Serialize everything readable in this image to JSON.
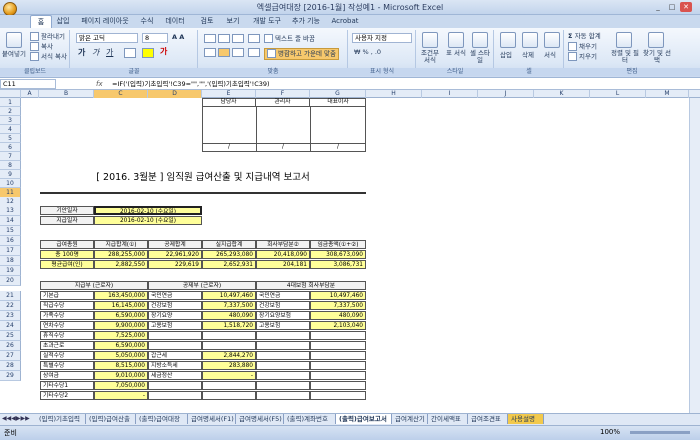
{
  "title": "엑셀급여대장 [2016-1월] 작성예1 - Microsoft Excel",
  "tabs": [
    "홈",
    "삽입",
    "페이지 레이아웃",
    "수식",
    "데이터",
    "검토",
    "보기",
    "개발 도구",
    "추가 기능",
    "Acrobat"
  ],
  "ribbon": {
    "paste": "붙여넣기",
    "cut": "잘라내기",
    "copy": "복사",
    "format_painter": "서식 복사",
    "font_name": "맑은 고딕",
    "font_size": "8",
    "wrap_text": "텍스트 줄 바꿈",
    "merge_center": "병합하고 가운데 맞춤",
    "number_format": "사용자 지정",
    "cond_format": "조건부 서식",
    "table_format": "표 서식",
    "cell_style": "셀 스타일",
    "insert": "삽입",
    "delete": "삭제",
    "format": "서식",
    "autosum": "자동 합계",
    "fill": "채우기",
    "clear": "지우기",
    "sort": "정렬 및 필터",
    "find": "찾기 및 선택",
    "groups": [
      "클립보드",
      "글꼴",
      "맞춤",
      "표시 형식",
      "스타일",
      "셀",
      "편집"
    ]
  },
  "formula_bar": {
    "cell": "C11",
    "fx": "fx",
    "formula": "=IF('(입력)기초입력'!C39=\"\",\"\",'(입력)기초입력'!C39)"
  },
  "columns": [
    "A",
    "B",
    "C",
    "D",
    "E",
    "F",
    "G",
    "H",
    "I",
    "J",
    "K",
    "L",
    "M"
  ],
  "rows": [
    "1",
    "2",
    "3",
    "4",
    "5",
    "6",
    "7",
    "8",
    "9",
    "10",
    "11",
    "12",
    "13",
    "14",
    "15",
    "16",
    "17",
    "18",
    "19",
    "20",
    "21",
    "22",
    "23",
    "24",
    "25",
    "26",
    "27",
    "28",
    "29"
  ],
  "approval": {
    "headers": [
      "담당자",
      "관리자",
      "대표이사"
    ],
    "marks": [
      "/",
      "/",
      "/"
    ]
  },
  "report_title": "[ 2016. 3월분 ] 임직원 급여산출 및 지급내역 보고서",
  "dates": [
    {
      "label": "기안일자",
      "value": "2016-02-10 (수요일)"
    },
    {
      "label": "지급일자",
      "value": "2016-02-10 (수요일)"
    }
  ],
  "summary": {
    "headers": [
      "급여총원",
      "지급합계(①)",
      "공제합계",
      "실지급합계",
      "회사부담분②",
      "임금총액(①+②)"
    ],
    "rows": [
      [
        "총 100명",
        "288,255,000",
        "22,961,920",
        "265,293,080",
        "20,418,090",
        "308,673,090"
      ],
      [
        "평균급여(인)",
        "2,882,550",
        "229,619",
        "2,652,931",
        "204,181",
        "3,086,731"
      ]
    ]
  },
  "detail_headers": [
    "지급부 (근로자)",
    "공제부 (근로자)",
    "4대보험 회사부담분"
  ],
  "pay_items": [
    [
      "기본급",
      "163,450,000"
    ],
    [
      "직급수당",
      "16,145,000"
    ],
    [
      "가족수당",
      "6,590,000"
    ],
    [
      "연차수당",
      "9,900,000"
    ],
    [
      "휴직수당",
      "7,525,000"
    ],
    [
      "초과근로",
      "6,590,000"
    ],
    [
      "실적수당",
      "5,050,000"
    ],
    [
      "특별수당",
      "8,515,000"
    ],
    [
      "상여금",
      "9,010,000"
    ],
    [
      "기타수당1",
      "7,050,000"
    ],
    [
      "기타수당2",
      "-"
    ]
  ],
  "deduction_items": [
    [
      "국민연금",
      "10,497,460"
    ],
    [
      "건강보험",
      "7,337,500"
    ],
    [
      "장기요양",
      "480,090"
    ],
    [
      "고용보험",
      "1,518,720"
    ],
    [
      "",
      ""
    ],
    [
      "",
      ""
    ],
    [
      "갑근세",
      "2,844,270"
    ],
    [
      "지방소득세",
      "283,880"
    ],
    [
      "세금정산",
      "-"
    ]
  ],
  "company_items": [
    [
      "국민연금",
      "10,497,460"
    ],
    [
      "건강보험",
      "7,337,500"
    ],
    [
      "장기요양보험",
      "480,090"
    ],
    [
      "고용보험",
      "2,103,040"
    ]
  ],
  "sheet_tabs": [
    "(입력)기초입력",
    "(입력)급여산출",
    "(출력)급여대장",
    "급여명세서(F1)",
    "급여명세서(F5)",
    "(출력)계좌번호",
    "(출력)급여보고서",
    "급여계산기",
    "간이세액표",
    "급여조견표",
    "사용설명"
  ],
  "active_sheet_index": 6,
  "status_text": "준비",
  "zoom": "100%",
  "colors": {
    "ribbon": "#dde8f6",
    "highlight": "#ffff99",
    "selected_header": "#f7c86c"
  }
}
